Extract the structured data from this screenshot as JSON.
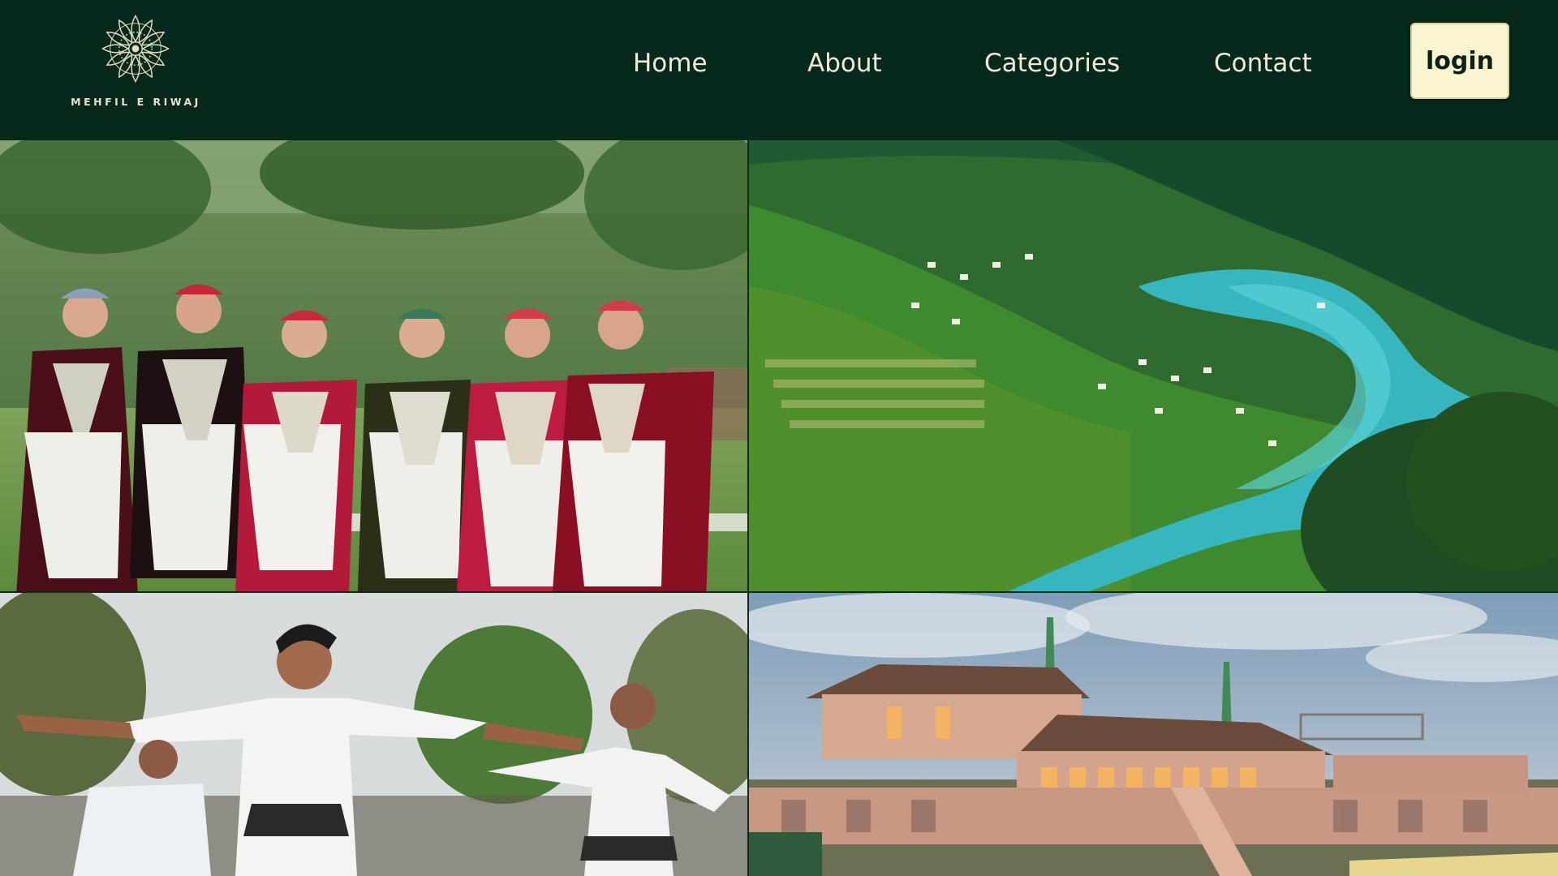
{
  "brand": {
    "name": "MEHFIL E RIWAJ",
    "logo_icon": "mandala-icon",
    "accent": "#e8e2cc"
  },
  "nav": {
    "items": [
      {
        "label": "Home"
      },
      {
        "label": "About"
      },
      {
        "label": "Categories"
      },
      {
        "label": "Contact"
      }
    ],
    "login_label": "login",
    "background": "#06291b",
    "login_background": "#fbf5cf"
  },
  "gallery": {
    "images": [
      {
        "subject": "dancers-in-traditional-pheran-photo"
      },
      {
        "subject": "valley-river-landscape-photo"
      },
      {
        "subject": "male-folk-dancers-photo"
      },
      {
        "subject": "houseboat-on-lake-photo"
      }
    ]
  }
}
